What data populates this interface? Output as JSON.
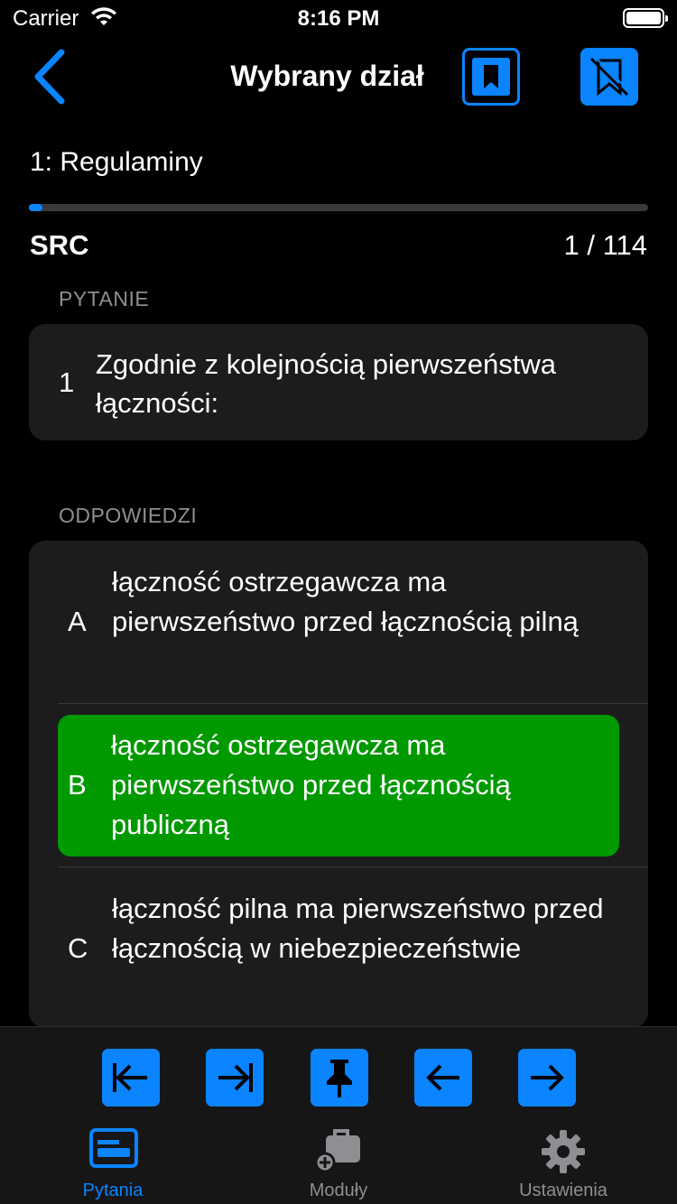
{
  "status": {
    "carrier": "Carrier",
    "time": "8:16 PM"
  },
  "nav": {
    "title": "Wybrany dział"
  },
  "section": {
    "title": "1:  Regulaminy",
    "progress_fraction": 0.022
  },
  "info": {
    "label": "SRC",
    "counter": "1  /  114"
  },
  "question": {
    "header": "PYTANIE",
    "number": "1",
    "text": "Zgodnie z kolejnością pierwszeństwa łączności:"
  },
  "answers": {
    "header": "ODPOWIEDZI",
    "items": [
      {
        "letter": "A",
        "text": "łączność ostrzegawcza ma pierwszeństwo przed łącznością pilną",
        "correct": false
      },
      {
        "letter": "B",
        "text": "łączność ostrzegawcza ma pierwszeństwo przed łącznością publiczną",
        "correct": true
      },
      {
        "letter": "C",
        "text": "łączność pilna ma pierwszeństwo przed łącznością w niebezpieczeństwie",
        "correct": false
      }
    ]
  },
  "toolbar": {
    "buttons": [
      "first-icon",
      "last-icon",
      "pin-icon",
      "arrow-left-icon",
      "arrow-right-icon"
    ]
  },
  "tabs": [
    {
      "label": "Pytania",
      "icon": "questions-icon",
      "active": true
    },
    {
      "label": "Moduły",
      "icon": "modules-icon",
      "active": false
    },
    {
      "label": "Ustawienia",
      "icon": "gear-icon",
      "active": false
    }
  ],
  "colors": {
    "accent": "#0a84ff",
    "correct": "#009900",
    "card": "#1c1c1e",
    "secondary_text": "#8e8e93",
    "inactive_tab": "#8e8e93"
  }
}
